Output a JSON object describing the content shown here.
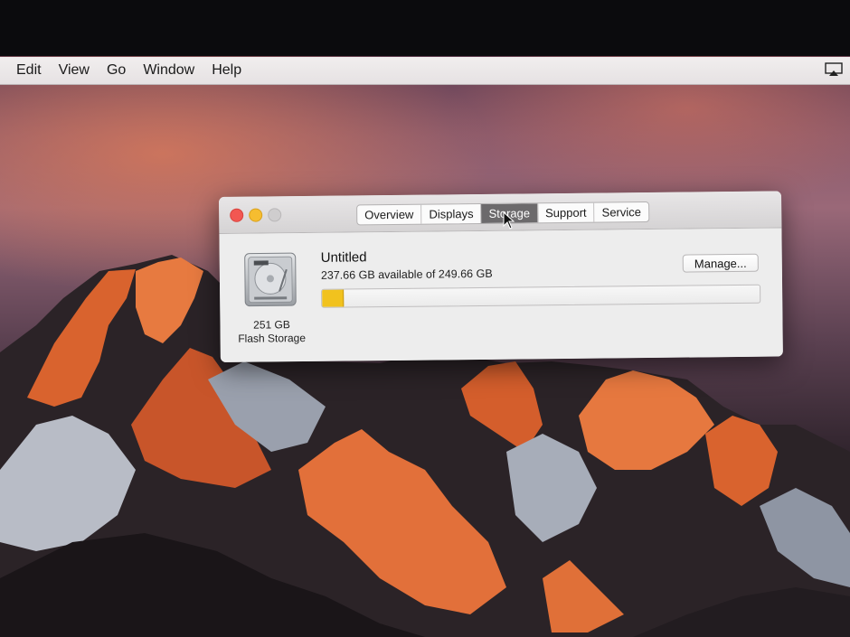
{
  "menubar": {
    "items": [
      "Edit",
      "View",
      "Go",
      "Window",
      "Help"
    ],
    "airplay_icon": "airplay-icon"
  },
  "window": {
    "tabs": [
      {
        "label": "Overview",
        "selected": false
      },
      {
        "label": "Displays",
        "selected": false
      },
      {
        "label": "Storage",
        "selected": true
      },
      {
        "label": "Support",
        "selected": false
      },
      {
        "label": "Service",
        "selected": false
      }
    ],
    "disk": {
      "icon": "hard-drive-icon",
      "size": "251 GB",
      "type": "Flash Storage"
    },
    "volume": {
      "name": "Untitled",
      "available": "237.66 GB available of 249.66 GB",
      "used_fraction": 0.048
    },
    "manage_label": "Manage..."
  },
  "colors": {
    "usage_fill": "#f1c21e",
    "selected_tab": "#6c6a6c",
    "close": "#f25752",
    "minimize": "#f6bd30",
    "zoom": "#cfcdce"
  }
}
